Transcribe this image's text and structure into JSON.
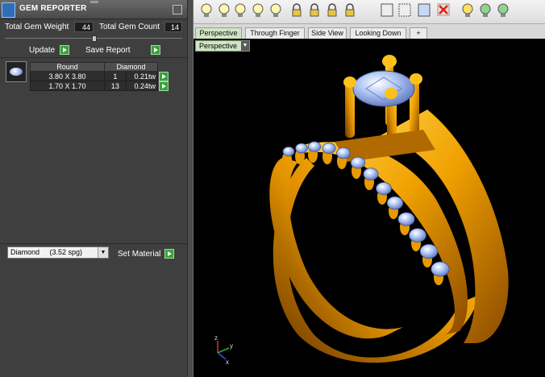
{
  "panel": {
    "title": "GEM REPORTER",
    "total_gem_weight_label": "Total Gem Weight",
    "total_gem_weight": "44",
    "total_gem_count_label": "Total Gem Count",
    "total_gem_count": "14",
    "update_label": "Update",
    "save_report_label": "Save Report"
  },
  "gem_table": {
    "headers": [
      "Round",
      "Diamond"
    ],
    "rows": [
      {
        "size": "3.80 X 3.80",
        "count": "1",
        "weight": "0.21tw"
      },
      {
        "size": "1.70 X 1.70",
        "count": "13",
        "weight": "0.24tw"
      }
    ]
  },
  "material": {
    "selected": "Diamond     (3.52 spg)",
    "set_label": "Set Material"
  },
  "tabs": [
    {
      "label": "Perspective",
      "active": true
    },
    {
      "label": "Through Finger",
      "active": false
    },
    {
      "label": "Side View",
      "active": false
    },
    {
      "label": "Looking Down",
      "active": false
    },
    {
      "label": "+",
      "active": false
    }
  ],
  "view_dropdown": "Perspective",
  "axes": {
    "x": "x",
    "y": "y",
    "z": "z"
  },
  "toolbar_icons": [
    "bulb-icon",
    "bulb-icon",
    "bulb-icon",
    "bulb-select-icon",
    "bulb-group-icon",
    "lock-icon",
    "lock-icon",
    "lock-select-icon",
    "lock-group-icon",
    "layer-icon",
    "select-grid-icon",
    "render-icon",
    "delete-icon",
    "bulb-yellow-icon",
    "bulb-green-icon",
    "bulb-green-icon"
  ],
  "colors": {
    "gold": "#f0a000",
    "gem": "#a8c4f0",
    "tab_active": "#cfe4c4",
    "go_button": "#3aa23a"
  }
}
